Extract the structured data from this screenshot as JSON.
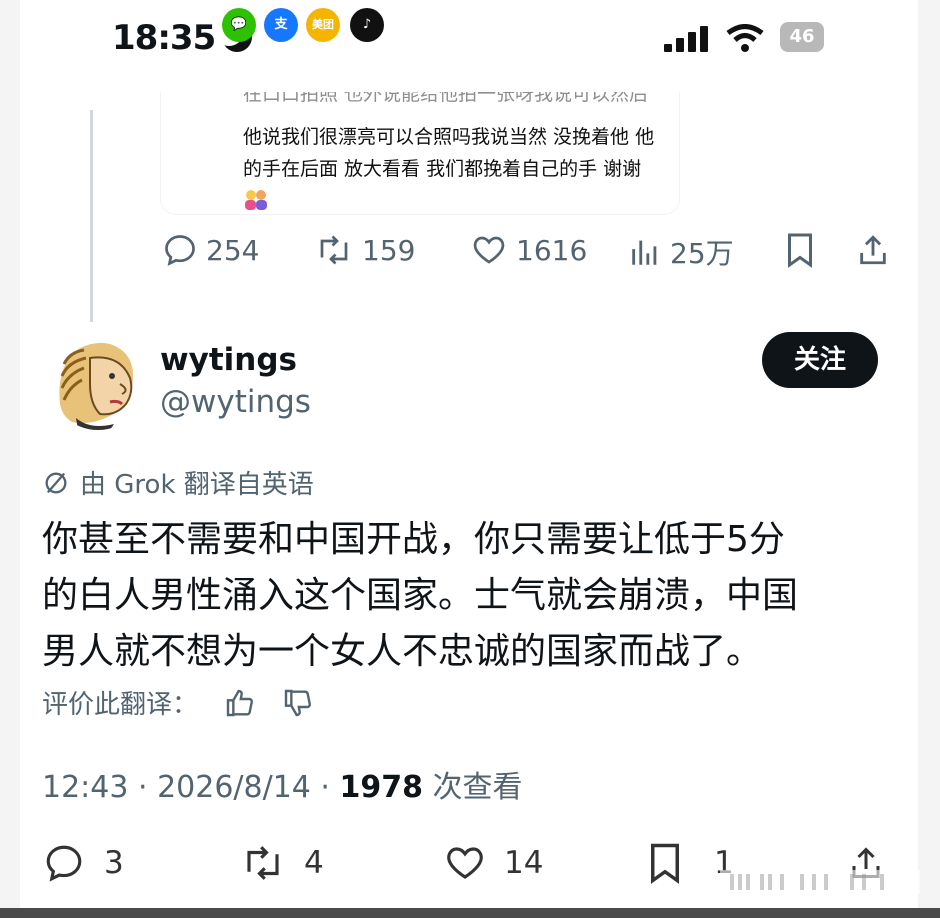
{
  "status_bar": {
    "time": "18:35",
    "apps": [
      {
        "name": "wechat-icon",
        "color": "#2dc100",
        "glyph": "💬"
      },
      {
        "name": "alipay-icon",
        "color": "#1677ff",
        "glyph": "支"
      },
      {
        "name": "meituan-icon",
        "color": "#f5b400",
        "glyph": "美团"
      },
      {
        "name": "tiktok-icon",
        "color": "#111111",
        "glyph": "♪"
      }
    ],
    "battery": "46"
  },
  "quoted_post": {
    "partial_line": "在口口拍照 也外说能给他拍一张呀我说可以然后",
    "lines": [
      "他说我们很漂亮可以合照吗我说当然 没挽着他 他",
      "的手在后面 放大看看 我们都挽着自己的手 谢谢"
    ],
    "actions": {
      "replies": "254",
      "reposts": "159",
      "likes": "1616",
      "views": "25万"
    }
  },
  "post": {
    "display_name": "wytings",
    "handle": "@wytings",
    "follow_label": "关注",
    "translated_notice": "由 Grok 翻译自英语",
    "text_lines": [
      "你甚至不需要和中国开战，你只需要让低于5分",
      "的白人男性涌入这个国家。士气就会崩溃，中国",
      "男人就不想为一个女人不忠诚的国家而战了。"
    ],
    "rate_label": "评价此翻译：",
    "timestamp": "12:43 · 2026/8/14 · ",
    "view_count": "1978",
    "view_label": " 次查看",
    "actions": {
      "replies": "3",
      "reposts": "4",
      "likes": "14",
      "bookmarks": "1"
    }
  }
}
